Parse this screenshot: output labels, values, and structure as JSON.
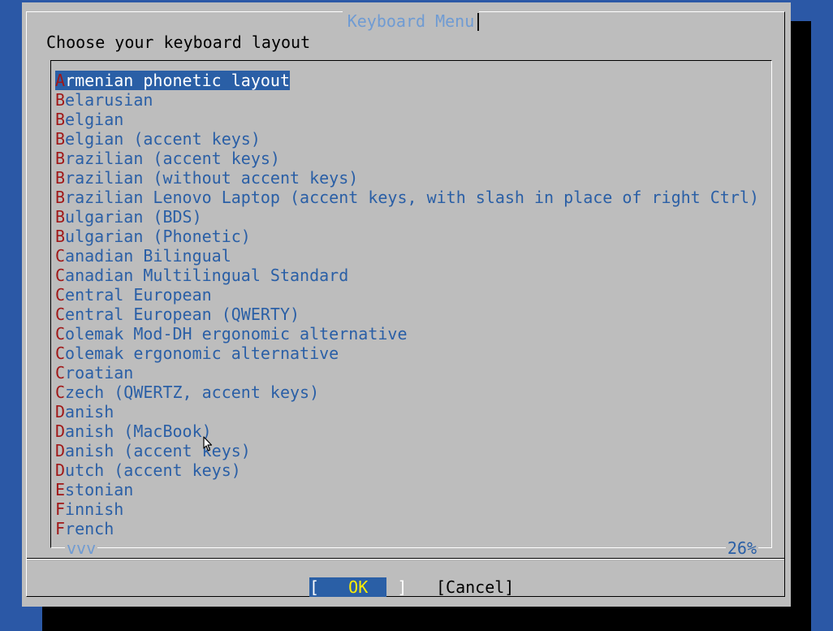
{
  "dialog": {
    "title": "Keyboard Menu",
    "prompt": "Choose your keyboard layout"
  },
  "list": {
    "selected_index": 0,
    "items": [
      {
        "hotkey": "A",
        "rest": "rmenian phonetic layout"
      },
      {
        "hotkey": "B",
        "rest": "elarusian"
      },
      {
        "hotkey": "B",
        "rest": "elgian"
      },
      {
        "hotkey": "B",
        "rest": "elgian (accent keys)"
      },
      {
        "hotkey": "B",
        "rest": "razilian (accent keys)"
      },
      {
        "hotkey": "B",
        "rest": "razilian (without accent keys)"
      },
      {
        "hotkey": "B",
        "rest": "razilian Lenovo Laptop (accent keys, with slash in place of right Ctrl)"
      },
      {
        "hotkey": "B",
        "rest": "ulgarian (BDS)"
      },
      {
        "hotkey": "B",
        "rest": "ulgarian (Phonetic)"
      },
      {
        "hotkey": "C",
        "rest": "anadian Bilingual"
      },
      {
        "hotkey": "C",
        "rest": "anadian Multilingual Standard"
      },
      {
        "hotkey": "C",
        "rest": "entral European"
      },
      {
        "hotkey": "C",
        "rest": "entral European (QWERTY)"
      },
      {
        "hotkey": "C",
        "rest": "olemak Mod-DH ergonomic alternative"
      },
      {
        "hotkey": "C",
        "rest": "olemak ergonomic alternative"
      },
      {
        "hotkey": "C",
        "rest": "roatian"
      },
      {
        "hotkey": "C",
        "rest": "zech (QWERTZ, accent keys)"
      },
      {
        "hotkey": "D",
        "rest": "anish"
      },
      {
        "hotkey": "D",
        "rest": "anish (MacBook)"
      },
      {
        "hotkey": "D",
        "rest": "anish (accent keys)"
      },
      {
        "hotkey": "D",
        "rest": "utch (accent keys)"
      },
      {
        "hotkey": "E",
        "rest": "stonian"
      },
      {
        "hotkey": "F",
        "rest": "innish"
      },
      {
        "hotkey": "F",
        "rest": "rench"
      }
    ],
    "scroll_indicator": "vvv",
    "scroll_percent": "26%"
  },
  "buttons": {
    "ok_left": "[",
    "ok_label": "OK",
    "ok_right": "]",
    "cancel_label": "[Cancel]"
  },
  "colors": {
    "background": "#2b58a6",
    "dialog": "#bdbdbd",
    "item_text": "#2a5fa6",
    "hotkey": "#a01818",
    "ok_label": "#ffee00"
  }
}
